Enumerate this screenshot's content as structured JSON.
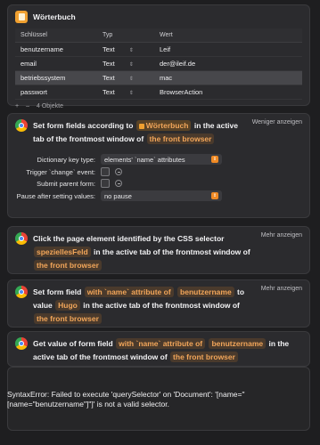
{
  "dictionary": {
    "title": "Wörterbuch",
    "columns": [
      "Schlüssel",
      "Typ",
      "Wert"
    ],
    "rows": [
      {
        "key": "benutzername",
        "type": "Text",
        "value": "Leif"
      },
      {
        "key": "email",
        "type": "Text",
        "value": "der@ileif.de"
      },
      {
        "key": "betriebssystem",
        "type": "Text",
        "value": "mac"
      },
      {
        "key": "passwort",
        "type": "Text",
        "value": "BrowserAction"
      }
    ],
    "add": "+",
    "remove": "–",
    "count": "4 Objekte"
  },
  "action1": {
    "prefix": "Set form fields according to",
    "var": "Wörterbuch",
    "mid": "in the active tab",
    "line2": "of the frontmost window of",
    "browser": "the front browser",
    "toggle": "Weniger anzeigen",
    "key_type_label": "Dictionary key type:",
    "key_type_value": "elements' `name` attributes",
    "trigger_label": "Trigger `change` event:",
    "submit_label": "Submit parent form:",
    "pause_label": "Pause after setting values:",
    "pause_value": "no pause"
  },
  "action2": {
    "text1": "Click the page element identified by the CSS selector",
    "token": "speziellesFeld",
    "text2": "in the active tab of the frontmost window of",
    "browser": "the front browser",
    "toggle": "Mehr anzeigen"
  },
  "action3": {
    "text1": "Set form field",
    "attr": "with `name` attribute of",
    "name": "benutzername",
    "text2": "to value",
    "value": "Hugo",
    "text3": "in the active tab of the frontmost window of",
    "browser": "the front browser",
    "toggle": "Mehr anzeigen"
  },
  "action4": {
    "text1": "Get value of form field",
    "attr": "with `name` attribute of",
    "name": "benutzername",
    "text2": "in the active",
    "text3": "tab of the frontmost window of",
    "browser": "the front browser"
  },
  "error": "SyntaxError: Failed to execute 'querySelector' on 'Document': '[name=\"[name=\"benutzername\"]\"]' is not a valid selector.",
  "colors": {
    "accent": "#f08a24",
    "token_text": "#f2a65a",
    "token_bg": "#4a3a2c"
  }
}
